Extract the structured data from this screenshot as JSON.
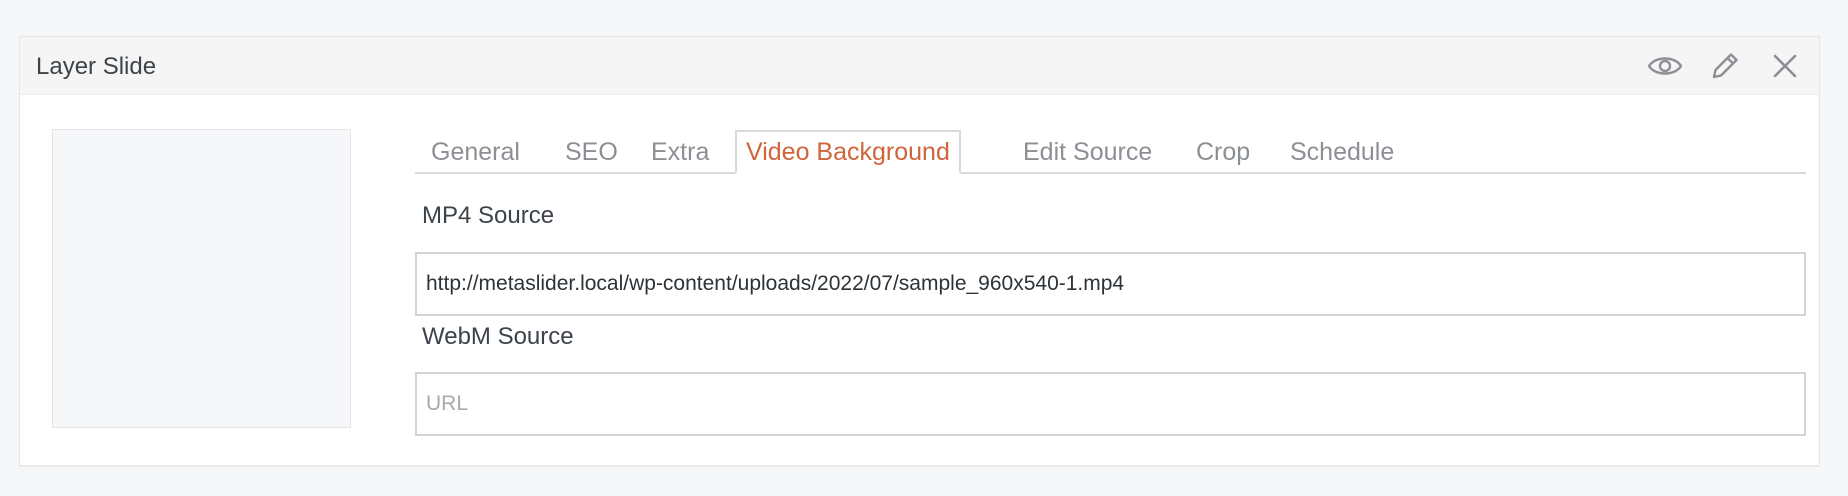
{
  "panel": {
    "title": "Layer Slide",
    "actions": [
      {
        "name": "preview-button",
        "icon": "eye-icon"
      },
      {
        "name": "edit-button",
        "icon": "pencil-icon"
      },
      {
        "name": "close-button",
        "icon": "close-icon"
      }
    ]
  },
  "tabs": [
    {
      "label": "General",
      "active": false
    },
    {
      "label": "SEO",
      "active": false
    },
    {
      "label": "Extra",
      "active": false
    },
    {
      "label": "Video Background",
      "active": true
    },
    {
      "label": "Edit Source",
      "active": false
    },
    {
      "label": "Crop",
      "active": false
    },
    {
      "label": "Schedule",
      "active": false
    }
  ],
  "fields": {
    "mp4": {
      "label": "MP4 Source",
      "value": "http://metaslider.local/wp-content/uploads/2022/07/sample_960x540-1.mp4",
      "placeholder": "URL"
    },
    "webm": {
      "label": "WebM Source",
      "value": "",
      "placeholder": "URL"
    }
  },
  "colors": {
    "accent": "#d0643a",
    "tab_inactive": "#8c8f94",
    "text": "#3c434a",
    "icon": "#8c8f94"
  }
}
